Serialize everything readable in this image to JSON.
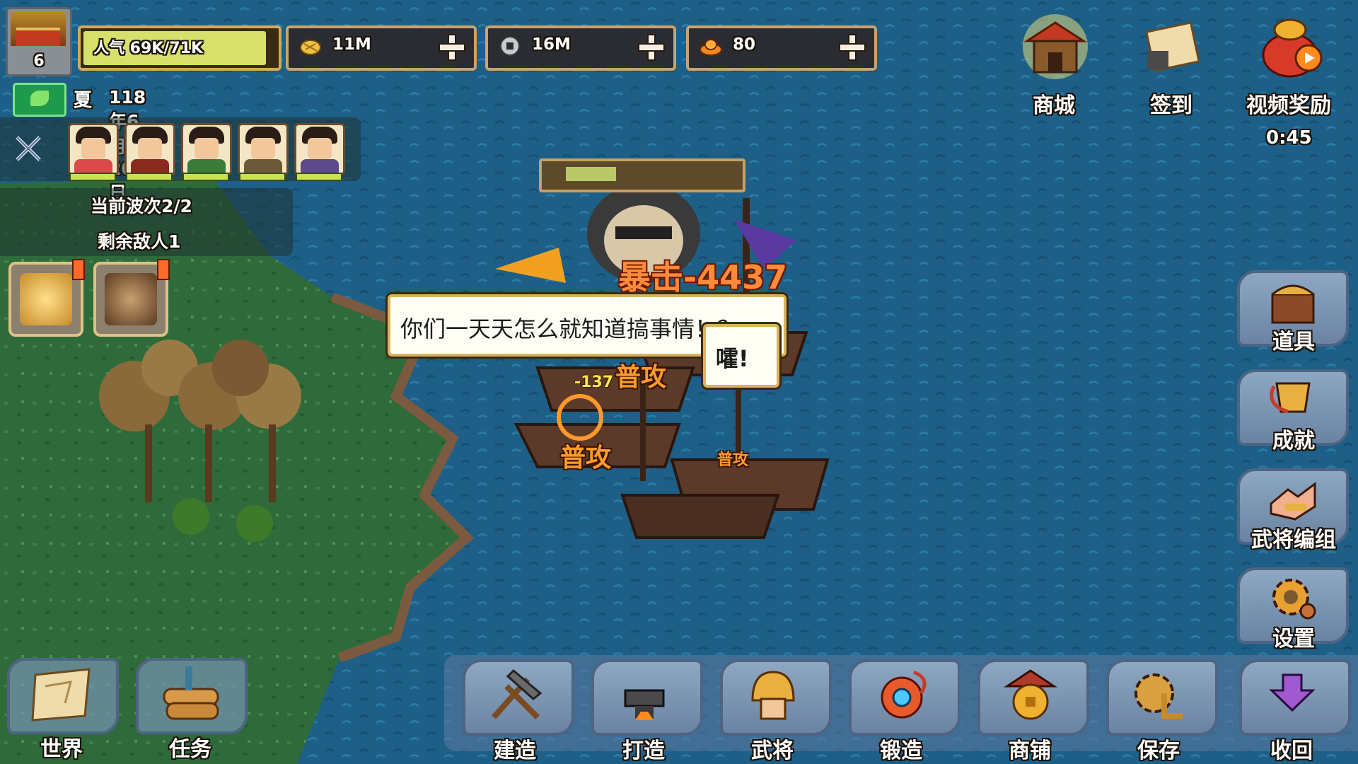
{
  "hud": {
    "level": "6",
    "popularity": "人气 69K/71K",
    "popularity_fraction": 0.97,
    "resources": [
      {
        "icon": "grain-icon",
        "value": "11M"
      },
      {
        "icon": "copper-coin-icon",
        "value": "16M"
      },
      {
        "icon": "gold-ingot-icon",
        "value": "80"
      }
    ],
    "season": "夏",
    "date": "118年6月20日",
    "wave": "当前波次2/2",
    "enemies_left": "剩余敌人1"
  },
  "heroes": [
    {
      "name": "hero-1",
      "robe": "#d94a4a"
    },
    {
      "name": "hero-2",
      "robe": "#8a2a1e"
    },
    {
      "name": "hero-3",
      "robe": "#3a7d3a"
    },
    {
      "name": "hero-4",
      "robe": "#6a5a3a"
    },
    {
      "name": "hero-5",
      "robe": "#5a4a8a"
    }
  ],
  "top_right": {
    "shop": "商城",
    "checkin": "签到",
    "video_reward": "视频奖励",
    "timer": "0:45"
  },
  "side_menu": {
    "items": "道具",
    "achievements": "成就",
    "formation": "武将编组",
    "settings": "设置"
  },
  "bottom_menu": {
    "world": "世界",
    "tasks": "任务",
    "build": "建造",
    "craft": "打造",
    "generals": "武将",
    "forge": "锻造",
    "store": "商铺",
    "save": "保存",
    "collapse": "收回"
  },
  "battle": {
    "boss_hp_fraction": 0.25,
    "dialog_main": "你们一天天怎么就知道搞事情！？",
    "dialog_reply": "嚯!",
    "crit_text": "暴击-4437",
    "attack_label": "普攻",
    "small_damage": "-137"
  },
  "colors": {
    "sea": "#1d5f86",
    "land": "#2f6a3a",
    "ui_gold": "#d7a955"
  }
}
